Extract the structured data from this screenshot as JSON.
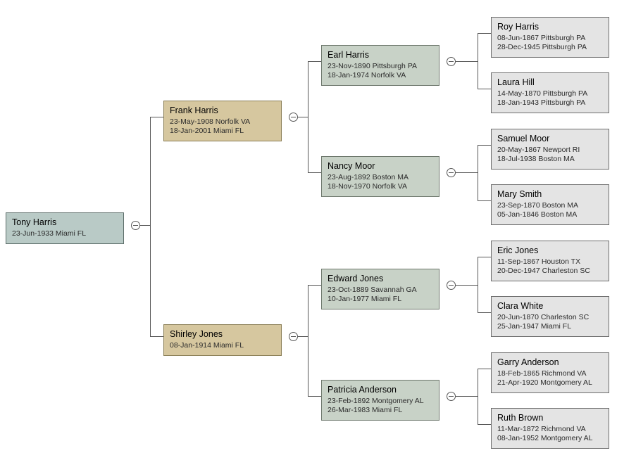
{
  "root": {
    "name": "Tony Harris",
    "birth": "23-Jun-1933 Miami FL"
  },
  "father": {
    "name": "Frank Harris",
    "birth": "23-May-1908 Norfolk VA",
    "death": "18-Jan-2001 Miami FL"
  },
  "mother": {
    "name": "Shirley Jones",
    "birth": "08-Jan-1914 Miami FL"
  },
  "pgf": {
    "name": "Earl Harris",
    "birth": "23-Nov-1890 Pittsburgh PA",
    "death": "18-Jan-1974 Norfolk VA"
  },
  "pgm": {
    "name": "Nancy Moor",
    "birth": "23-Aug-1892 Boston MA",
    "death": "18-Nov-1970 Norfolk VA"
  },
  "mgf": {
    "name": "Edward Jones",
    "birth": "23-Oct-1889 Savannah GA",
    "death": "10-Jan-1977 Miami FL"
  },
  "mgm": {
    "name": "Patricia Anderson",
    "birth": "23-Feb-1892 Montgomery AL",
    "death": "26-Mar-1983 Miami FL"
  },
  "ggp1": {
    "name": "Roy Harris",
    "birth": "08-Jun-1867 Pittsburgh PA",
    "death": "28-Dec-1945 Pittsburgh PA"
  },
  "ggp2": {
    "name": "Laura Hill",
    "birth": "14-May-1870 Pittsburgh PA",
    "death": "18-Jan-1943 Pittsburgh PA"
  },
  "ggp3": {
    "name": "Samuel Moor",
    "birth": "20-May-1867 Newport RI",
    "death": "18-Jul-1938 Boston MA"
  },
  "ggp4": {
    "name": "Mary Smith",
    "birth": "23-Sep-1870 Boston MA",
    "death": "05-Jan-1846 Boston MA"
  },
  "ggp5": {
    "name": "Eric Jones",
    "birth": "11-Sep-1867  Houston TX",
    "death": "20-Dec-1947 Charleston SC"
  },
  "ggp6": {
    "name": "Clara White",
    "birth": "20-Jun-1870 Charleston SC",
    "death": "25-Jan-1947 Miami FL"
  },
  "ggp7": {
    "name": "Garry Anderson",
    "birth": "18-Feb-1865 Richmond VA",
    "death": "21-Apr-1920 Montgomery AL"
  },
  "ggp8": {
    "name": "Ruth Brown",
    "birth": "11-Mar-1872 Richmond VA",
    "death": "08-Jan-1952 Montgomery AL"
  }
}
